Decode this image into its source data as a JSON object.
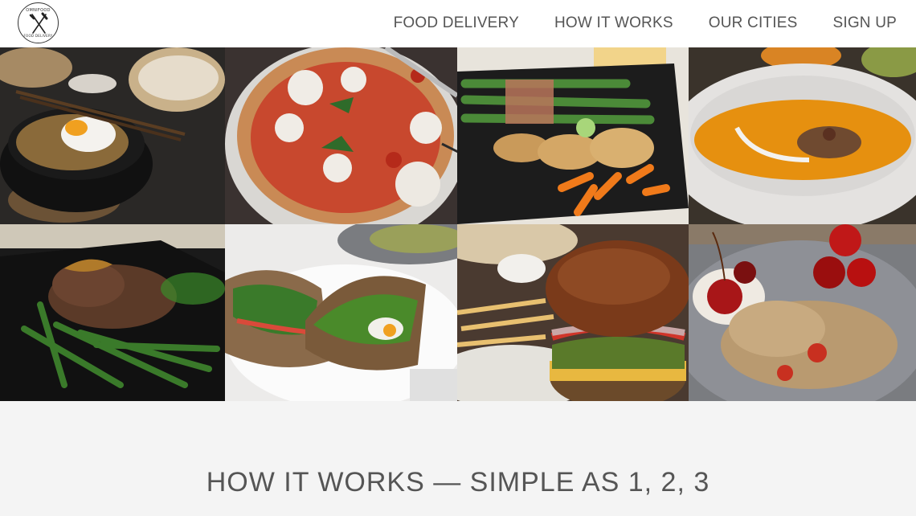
{
  "logo": {
    "top_text": "OMNIFOOD",
    "bottom_text": "FOOD DELIVERY",
    "icon": "fork-and-knife-icon"
  },
  "nav": {
    "items": [
      "FOOD DELIVERY",
      "HOW IT WORKS",
      "OUR CITIES",
      "SIGN UP"
    ]
  },
  "gallery": {
    "photos": [
      "bibimbap",
      "pizza",
      "asparagus-chicken",
      "pumpkin-soup",
      "steak-green-beans",
      "sandwich",
      "burger",
      "granola-cherries"
    ]
  },
  "section": {
    "title": "HOW IT WORKS — SIMPLE AS 1, 2, 3"
  },
  "colors": {
    "header_bg": "#ffffff",
    "section_bg": "#f4f4f4",
    "text": "#555555"
  }
}
